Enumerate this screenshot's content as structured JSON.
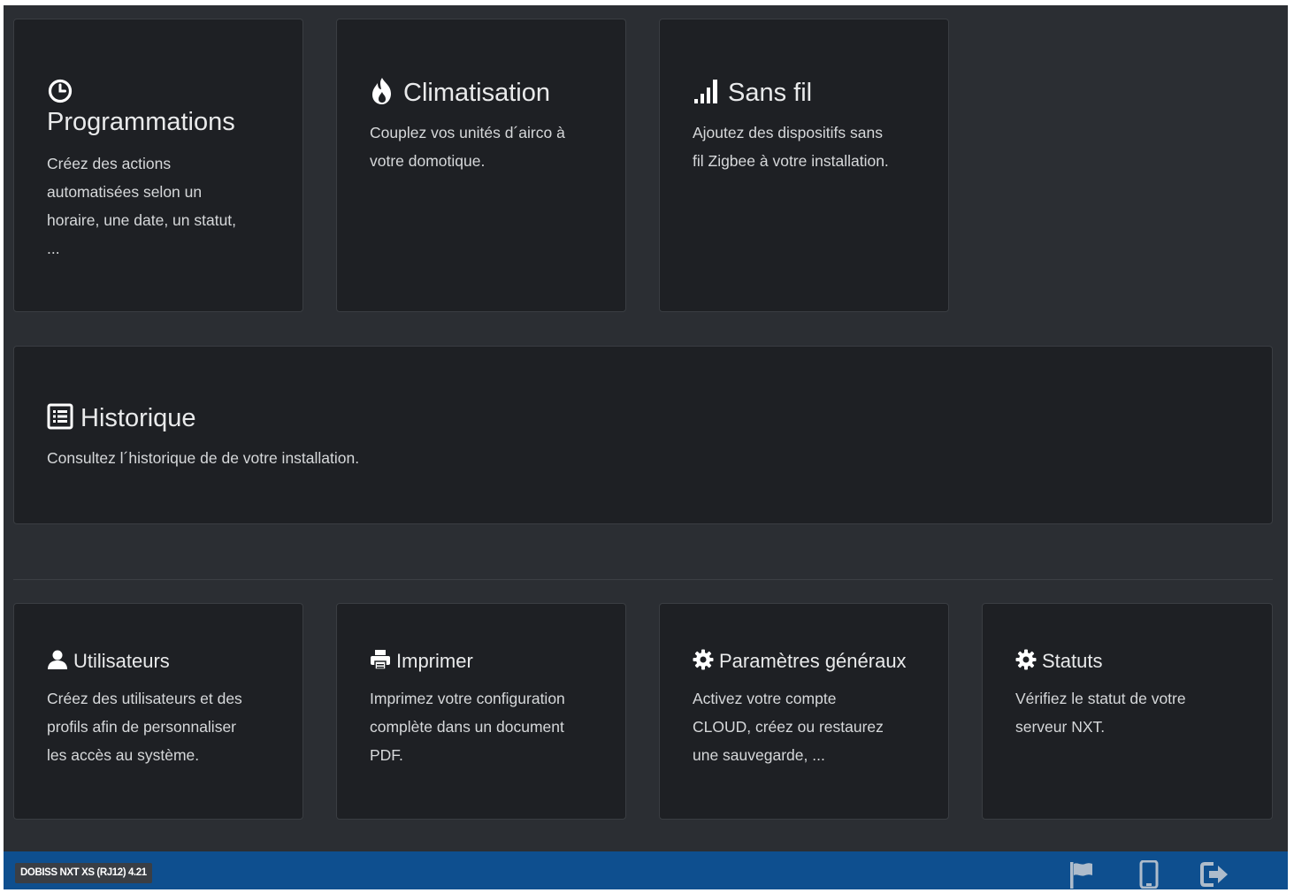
{
  "cards": {
    "programmations": {
      "icon": "clock-icon",
      "title": "Programmations",
      "desc_lines": [
        "Créez des actions",
        "automatisées selon un",
        "horaire, une date, un statut,",
        "..."
      ]
    },
    "climatisation": {
      "icon": "fire-icon",
      "title": "Climatisation",
      "desc_lines": [
        "Couplez vos unités d´airco à",
        "votre domotique."
      ]
    },
    "sans_fil": {
      "icon": "signal-bars-icon",
      "title": "Sans fil",
      "desc_lines": [
        "Ajoutez des dispositifs sans",
        "fil Zigbee à votre installation."
      ]
    },
    "historique": {
      "icon": "list-icon",
      "title": "Historique",
      "desc_lines": [
        "Consultez l´historique de de votre installation."
      ]
    },
    "utilisateurs": {
      "icon": "user-icon",
      "title": "Utilisateurs",
      "desc_lines": [
        "Créez des utilisateurs et des",
        "profils afin de personnaliser",
        "les accès au système."
      ]
    },
    "imprimer": {
      "icon": "printer-icon",
      "title": "Imprimer",
      "desc_lines": [
        "Imprimez votre configuration",
        "complète dans un document",
        "PDF."
      ]
    },
    "parametres": {
      "icon": "gear-icon",
      "title": "Paramètres généraux",
      "desc_lines": [
        "Activez votre compte",
        "CLOUD, créez ou restaurez",
        "une sauvegarde, ..."
      ]
    },
    "statuts": {
      "icon": "gear-icon",
      "title": "Statuts",
      "desc_lines": [
        "Vérifiez le statut de votre",
        "serveur NXT."
      ]
    }
  },
  "footer": {
    "version": "DOBISS NXT XS (RJ12) 4.21",
    "buttons": [
      "flag-icon",
      "mobile-icon",
      "logout-icon"
    ]
  },
  "colors": {
    "background": "#2b2e33",
    "card": "#1e2024",
    "footer": "#0e4f8f"
  }
}
